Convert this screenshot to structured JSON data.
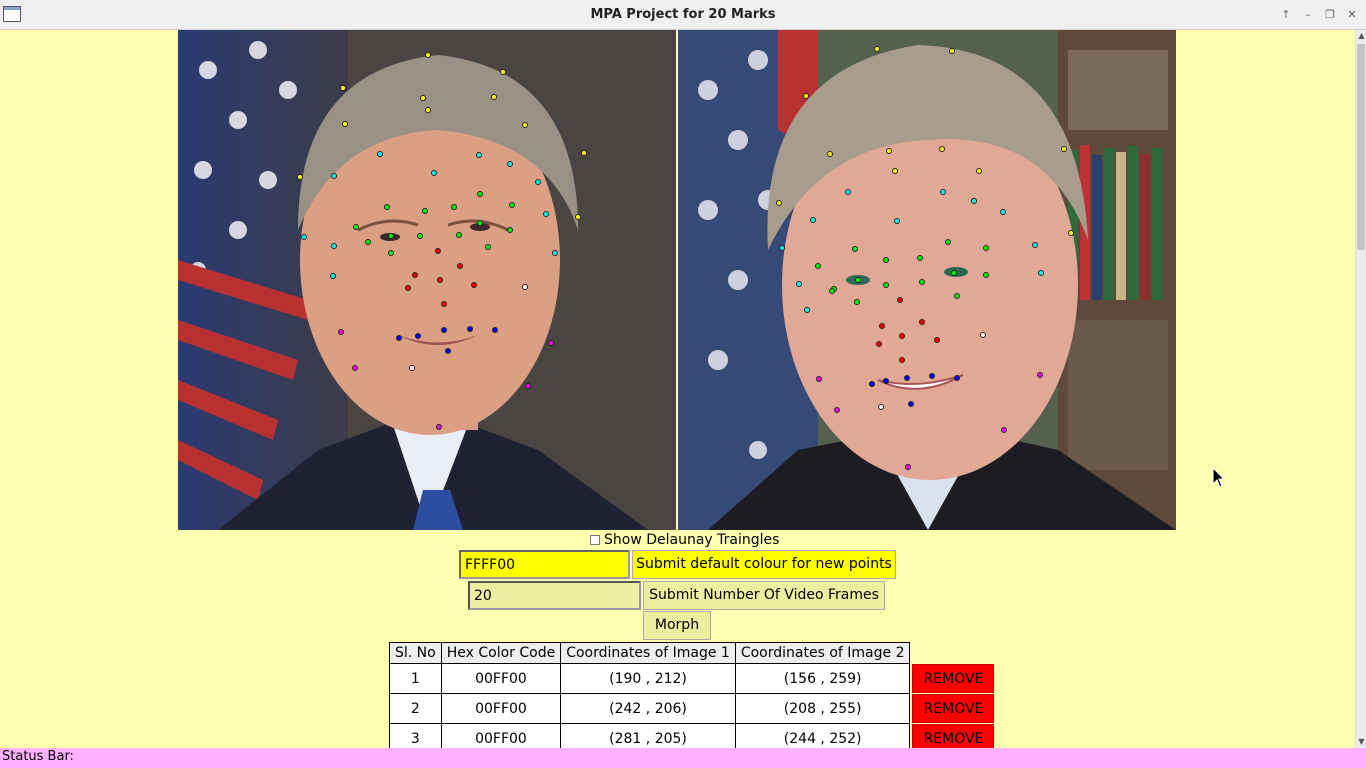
{
  "window": {
    "title": "MPA Project for 20 Marks",
    "controls": [
      "↑",
      "–",
      "❐",
      "✕"
    ]
  },
  "images": {
    "left_icon": "face-photo-icon",
    "right_icon": "face-photo-icon"
  },
  "options": {
    "delaunay_label": "Show Delaunay Traingles",
    "delaunay_checked": false
  },
  "colour_form": {
    "value": "FFFF00",
    "button_label": "Submit default colour for new points"
  },
  "frames_form": {
    "value": "20",
    "button_label": "Submit Number Of Video Frames"
  },
  "morph": {
    "label": "Morph"
  },
  "points_table": {
    "headers": [
      "Sl. No",
      "Hex Color Code",
      "Coordinates of Image 1",
      "Coordinates of Image 2"
    ],
    "remove_label": "REMOVE",
    "rows": [
      {
        "no": "1",
        "hex": "00FF00",
        "img1": "(190 , 212)",
        "img2": "(156 , 259)"
      },
      {
        "no": "2",
        "hex": "00FF00",
        "img1": "(242 , 206)",
        "img2": "(208 , 255)"
      },
      {
        "no": "3",
        "hex": "00FF00",
        "img1": "(281 , 205)",
        "img2": "(244 , 252)"
      }
    ]
  },
  "status_bar": {
    "text": "Status Bar:"
  },
  "colors": {
    "background": "#ffffb0",
    "accent_yellow": "#ffff00",
    "remove_red": "#ff0000",
    "status_pink": "#ffb0ff"
  }
}
